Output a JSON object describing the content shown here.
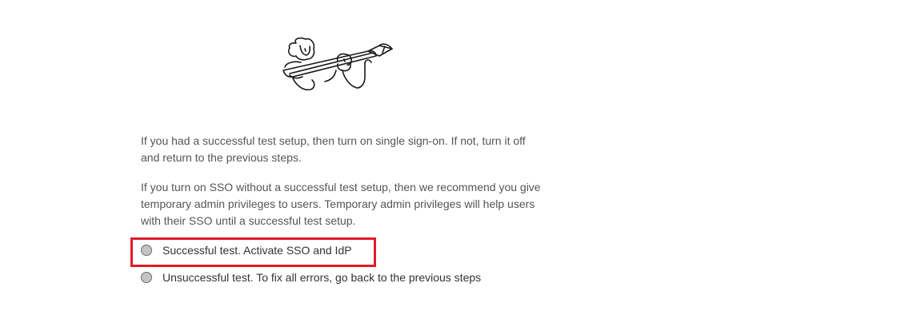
{
  "instructions": {
    "paragraph_1": "If you had a successful test setup, then turn on single sign-on. If not, turn it off and return to the previous steps.",
    "paragraph_2": "If you turn on SSO without a successful test setup, then we recommend you give temporary admin privileges to users. Temporary admin privileges will help users with their SSO until a successful test setup."
  },
  "options": [
    {
      "label": "Successful test. Activate SSO and IdP"
    },
    {
      "label": "Unsuccessful test. To fix all errors, go back to the previous steps"
    }
  ],
  "colors": {
    "highlight": "#e01a2b",
    "radio_fill": "#c4c4c4"
  },
  "icons": {
    "illustration": "people-carrying-pencil-illustration"
  }
}
